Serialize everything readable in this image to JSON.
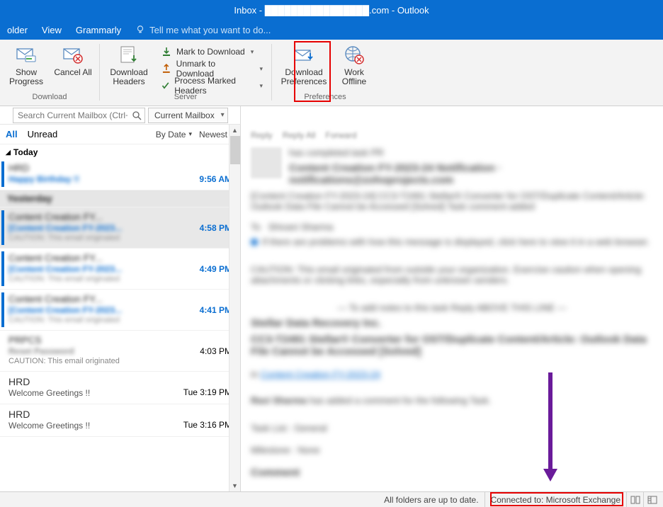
{
  "window": {
    "title": "Inbox - ████████████████.com - Outlook"
  },
  "menu": {
    "items": [
      "older",
      "View",
      "Grammarly"
    ],
    "tell_me": "Tell me what you want to do..."
  },
  "ribbon": {
    "download_group": "Download",
    "show_progress": "Show Progress",
    "cancel_all": "Cancel All",
    "download_headers": "Download Headers",
    "server_group": "Server",
    "mark_to_download": "Mark to Download",
    "unmark_to_download": "Unmark to Download",
    "process_marked": "Process Marked Headers",
    "preferences_group": "Preferences",
    "download_preferences": "Download Preferences",
    "work_offline": "Work Offline"
  },
  "search": {
    "placeholder": "Search Current Mailbox (Ctrl+E)",
    "scope": "Current Mailbox"
  },
  "list": {
    "filter_all": "All",
    "filter_unread": "Unread",
    "sort_by": "By Date",
    "sort_dir": "Newest",
    "group_today": "Today",
    "items": [
      {
        "from": "HRD",
        "subject": "Happy Birthday !!",
        "preview": "",
        "time": "9:56 AM",
        "unread": true,
        "blur": true
      },
      {
        "from": "Yesterday",
        "subject": "",
        "preview": "",
        "time": "",
        "unread": false,
        "blur": true,
        "is_group": true
      },
      {
        "from": "Content Creation FY...",
        "subject": "[Content Creation FY-2023...",
        "preview": "CAUTION: This email originated",
        "time": "4:58 PM",
        "unread": true,
        "blur": true,
        "selected": true
      },
      {
        "from": "Content Creation FY...",
        "subject": "[Content Creation FY-2023...",
        "preview": "CAUTION: This email originated",
        "time": "4:49 PM",
        "unread": true,
        "blur": true
      },
      {
        "from": "Content Creation FY...",
        "subject": "[Content Creation FY-2023...",
        "preview": "CAUTION: This email originated",
        "time": "4:41 PM",
        "unread": true,
        "blur": true
      },
      {
        "from": "PRPCS",
        "subject": "Reset Password",
        "preview": "CAUTION: This email originated",
        "time": "4:03 PM",
        "unread": false,
        "blur": true
      },
      {
        "from": "HRD",
        "subject": "Welcome Greetings !!",
        "preview": "",
        "time": "Tue 3:19 PM",
        "unread": false,
        "blur": false
      },
      {
        "from": "HRD",
        "subject": "Welcome Greetings !!",
        "preview": "",
        "time": "Tue 3:16 PM",
        "unread": false,
        "blur": false
      }
    ]
  },
  "reading": {
    "reply": "Reply",
    "reply_all": "Reply All",
    "forward": "Forward"
  },
  "status": {
    "folders": "All folders are up to date.",
    "connected": "Connected to: Microsoft Exchange"
  }
}
